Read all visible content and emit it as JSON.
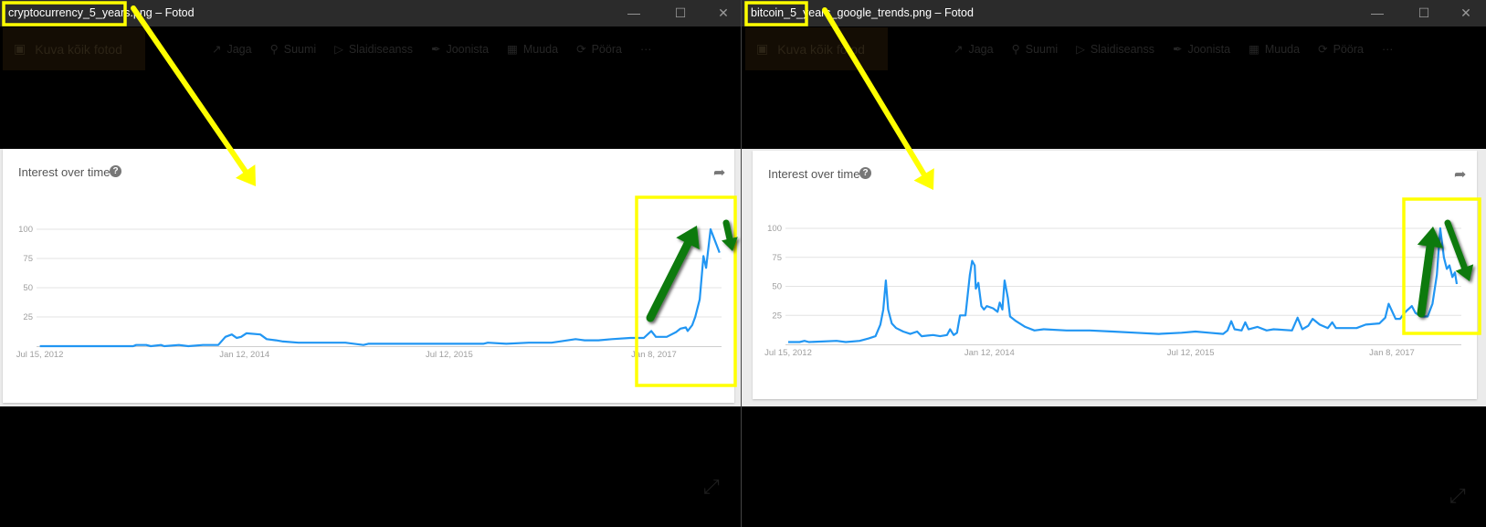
{
  "windows": [
    {
      "title": "cryptocurrency_5_years.png – Fotod",
      "toolbar": {
        "all_photos": "Kuva kõik fotod",
        "share": "Jaga",
        "zoom": "Suumi",
        "slideshow": "Slaidiseanss",
        "draw": "Joonista",
        "edit": "Muuda",
        "rotate": "Pööra",
        "more": "···"
      },
      "panel": {
        "title": "Interest over time",
        "help": "?"
      }
    },
    {
      "title": "bitcoin_5_years_google_trends.png – Fotod",
      "toolbar": {
        "all_photos": "Kuva kõik fotod",
        "share": "Jaga",
        "zoom": "Suumi",
        "slideshow": "Slaidiseanss",
        "draw": "Joonista",
        "edit": "Muuda",
        "rotate": "Pööra",
        "more": "···"
      },
      "panel": {
        "title": "Interest over time",
        "help": "?"
      }
    }
  ],
  "colors": {
    "line": "#2196f3",
    "highlight": "#ffff00",
    "trend_arrow": "#0a7a0a",
    "titlebar": "#2b2b2b"
  },
  "chart_data": [
    {
      "type": "line",
      "ylim": [
        0,
        100
      ],
      "yticks": [
        25,
        50,
        75,
        100
      ],
      "xticks": [
        {
          "date": "2012-07-15",
          "label": "Jul 15, 2012"
        },
        {
          "date": "2014-01-12",
          "label": "Jan 12, 2014"
        },
        {
          "date": "2015-07-12",
          "label": "Jul 12, 2015"
        },
        {
          "date": "2017-01-08",
          "label": "Jan 8, 2017"
        }
      ],
      "grid": true,
      "points": [
        [
          "2012-07-15",
          0
        ],
        [
          "2013-03-21",
          0
        ],
        [
          "2013-03-29",
          1
        ],
        [
          "2013-04-25",
          1
        ],
        [
          "2013-05-07",
          0
        ],
        [
          "2013-06-03",
          1
        ],
        [
          "2013-06-12",
          0
        ],
        [
          "2013-07-21",
          1
        ],
        [
          "2013-08-15",
          0
        ],
        [
          "2013-09-23",
          1
        ],
        [
          "2013-11-03",
          1
        ],
        [
          "2013-11-22",
          8
        ],
        [
          "2013-12-09",
          10
        ],
        [
          "2013-12-22",
          7
        ],
        [
          "2014-01-03",
          8
        ],
        [
          "2014-01-17",
          11
        ],
        [
          "2014-02-23",
          10
        ],
        [
          "2014-03-12",
          6
        ],
        [
          "2014-04-06",
          5
        ],
        [
          "2014-04-25",
          4
        ],
        [
          "2014-06-05",
          3
        ],
        [
          "2014-10-08",
          3
        ],
        [
          "2014-11-25",
          1
        ],
        [
          "2014-12-08",
          2
        ],
        [
          "2015-04-08",
          2
        ],
        [
          "2015-07-05",
          2
        ],
        [
          "2015-10-11",
          2
        ],
        [
          "2015-10-23",
          3
        ],
        [
          "2015-12-11",
          2
        ],
        [
          "2016-02-09",
          3
        ],
        [
          "2016-04-10",
          3
        ],
        [
          "2016-06-13",
          6
        ],
        [
          "2016-07-07",
          5
        ],
        [
          "2016-08-13",
          5
        ],
        [
          "2016-09-18",
          6
        ],
        [
          "2016-11-06",
          7
        ],
        [
          "2016-12-12",
          7
        ],
        [
          "2017-01-01",
          13
        ],
        [
          "2017-01-13",
          8
        ],
        [
          "2017-02-11",
          8
        ],
        [
          "2017-03-08",
          12
        ],
        [
          "2017-03-20",
          15
        ],
        [
          "2017-04-03",
          16
        ],
        [
          "2017-04-08",
          13
        ],
        [
          "2017-04-20",
          18
        ],
        [
          "2017-04-28",
          25
        ],
        [
          "2017-05-10",
          40
        ],
        [
          "2017-05-20",
          77
        ],
        [
          "2017-05-27",
          67
        ],
        [
          "2017-06-08",
          100
        ],
        [
          "2017-06-20",
          90
        ],
        [
          "2017-07-02",
          80
        ]
      ]
    },
    {
      "type": "line",
      "ylim": [
        0,
        100
      ],
      "yticks": [
        25,
        50,
        75,
        100
      ],
      "xticks": [
        {
          "date": "2012-07-15",
          "label": "Jul 15, 2012"
        },
        {
          "date": "2014-01-12",
          "label": "Jan 12, 2014"
        },
        {
          "date": "2015-07-12",
          "label": "Jul 12, 2015"
        },
        {
          "date": "2017-01-08",
          "label": "Jan 8, 2017"
        }
      ],
      "grid": true,
      "points": [
        [
          "2012-07-15",
          2
        ],
        [
          "2012-08-15",
          2
        ],
        [
          "2012-08-28",
          3
        ],
        [
          "2012-09-09",
          2
        ],
        [
          "2012-11-23",
          3
        ],
        [
          "2012-12-18",
          2
        ],
        [
          "2013-01-25",
          3
        ],
        [
          "2013-02-18",
          5
        ],
        [
          "2013-03-09",
          7
        ],
        [
          "2013-03-22",
          17
        ],
        [
          "2013-03-30",
          30
        ],
        [
          "2013-04-06",
          55
        ],
        [
          "2013-04-12",
          30
        ],
        [
          "2013-04-22",
          18
        ],
        [
          "2013-05-04",
          14
        ],
        [
          "2013-05-23",
          11
        ],
        [
          "2013-06-11",
          9
        ],
        [
          "2013-06-30",
          11
        ],
        [
          "2013-07-12",
          7
        ],
        [
          "2013-08-12",
          8
        ],
        [
          "2013-08-31",
          7
        ],
        [
          "2013-09-19",
          8
        ],
        [
          "2013-09-27",
          13
        ],
        [
          "2013-10-07",
          8
        ],
        [
          "2013-10-16",
          10
        ],
        [
          "2013-10-24",
          25
        ],
        [
          "2013-11-08",
          25
        ],
        [
          "2013-11-20",
          60
        ],
        [
          "2013-11-26",
          72
        ],
        [
          "2013-12-03",
          68
        ],
        [
          "2013-12-06",
          48
        ],
        [
          "2013-12-13",
          53
        ],
        [
          "2013-12-21",
          33
        ],
        [
          "2013-12-28",
          30
        ],
        [
          "2014-01-05",
          33
        ],
        [
          "2014-01-22",
          31
        ],
        [
          "2014-02-03",
          28
        ],
        [
          "2014-02-09",
          36
        ],
        [
          "2014-02-16",
          30
        ],
        [
          "2014-02-22",
          55
        ],
        [
          "2014-03-03",
          40
        ],
        [
          "2014-03-09",
          24
        ],
        [
          "2014-03-25",
          20
        ],
        [
          "2014-04-19",
          15
        ],
        [
          "2014-05-14",
          12
        ],
        [
          "2014-06-08",
          13
        ],
        [
          "2014-08-09",
          12
        ],
        [
          "2014-10-11",
          12
        ],
        [
          "2014-12-12",
          11
        ],
        [
          "2015-02-13",
          10
        ],
        [
          "2015-04-16",
          9
        ],
        [
          "2015-06-17",
          10
        ],
        [
          "2015-07-25",
          11
        ],
        [
          "2015-08-31",
          10
        ],
        [
          "2015-10-08",
          9
        ],
        [
          "2015-10-20",
          12
        ],
        [
          "2015-10-30",
          20
        ],
        [
          "2015-11-08",
          13
        ],
        [
          "2015-11-27",
          12
        ],
        [
          "2015-12-07",
          19
        ],
        [
          "2015-12-16",
          13
        ],
        [
          "2016-01-09",
          15
        ],
        [
          "2016-02-03",
          12
        ],
        [
          "2016-02-22",
          13
        ],
        [
          "2016-04-12",
          12
        ],
        [
          "2016-04-27",
          23
        ],
        [
          "2016-05-10",
          13
        ],
        [
          "2016-05-26",
          16
        ],
        [
          "2016-06-07",
          22
        ],
        [
          "2016-06-26",
          17
        ],
        [
          "2016-07-18",
          14
        ],
        [
          "2016-07-30",
          19
        ],
        [
          "2016-08-09",
          14
        ],
        [
          "2016-10-04",
          14
        ],
        [
          "2016-10-29",
          17
        ],
        [
          "2016-12-05",
          18
        ],
        [
          "2016-12-21",
          23
        ],
        [
          "2016-12-30",
          35
        ],
        [
          "2017-01-18",
          22
        ],
        [
          "2017-01-30",
          22
        ],
        [
          "2017-02-14",
          28
        ],
        [
          "2017-03-03",
          33
        ],
        [
          "2017-03-13",
          27
        ],
        [
          "2017-03-28",
          24
        ],
        [
          "2017-04-15",
          24
        ],
        [
          "2017-04-28",
          35
        ],
        [
          "2017-05-10",
          60
        ],
        [
          "2017-05-19",
          100
        ],
        [
          "2017-05-29",
          75
        ],
        [
          "2017-06-06",
          65
        ],
        [
          "2017-06-13",
          68
        ],
        [
          "2017-06-21",
          58
        ],
        [
          "2017-06-28",
          62
        ],
        [
          "2017-07-03",
          52
        ]
      ]
    }
  ]
}
